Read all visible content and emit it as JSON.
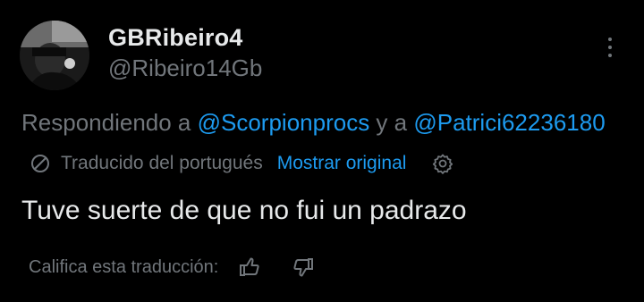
{
  "author": {
    "display_name": "GBRibeiro4",
    "handle": "@Ribeiro14Gb",
    "avatar_icon": "user-avatar-photo"
  },
  "more_icon": "more-dots-vertical-icon",
  "reply": {
    "prefix": "Respondiendo a ",
    "mention1": "@Scorpionprocs",
    "joiner": " y a ",
    "mention2": "@Patrici62236180"
  },
  "translation": {
    "icon": "translate-globe-icon",
    "translated_from": "Traducido del portugués",
    "show_original": "Mostrar original",
    "settings_icon": "gear-icon"
  },
  "tweet": {
    "text": "Tuve suerte de que no fui un padrazo"
  },
  "rating": {
    "label": "Califica esta traducción:",
    "thumb_up_icon": "thumbs-up-icon",
    "thumb_down_icon": "thumbs-down-icon"
  },
  "colors": {
    "background": "#000000",
    "primary_text": "#e7e9ea",
    "secondary_text": "#71767b",
    "link": "#1d9bf0"
  }
}
